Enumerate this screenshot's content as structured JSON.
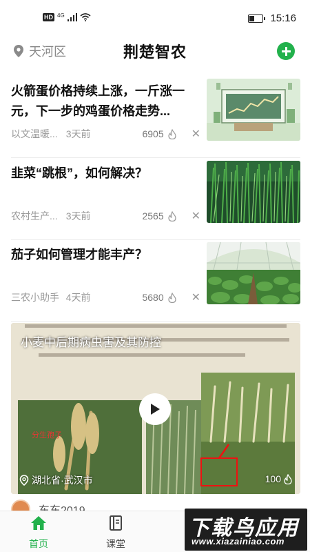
{
  "status_bar": {
    "hd": "HD",
    "network": "4G",
    "time": "15:16",
    "battery_level": 0.4
  },
  "header": {
    "location": "天河区",
    "title": "荆楚智农",
    "add_icon": "plus-circle-icon",
    "accent": "#22b14c"
  },
  "feed": [
    {
      "title": "火箭蛋价格持续上涨，一斤涨一元，下一步的鸡蛋价格走势...",
      "source": "以文温暖...",
      "time": "3天前",
      "views": "6905",
      "thumb": "chart-office-illustration"
    },
    {
      "title": "韭菜“跳根”，如何解决？",
      "source": "农村生产...",
      "time": "3天前",
      "views": "2565",
      "thumb": "chives-field-photo"
    },
    {
      "title": "茄子如何管理才能丰产？",
      "source": "三农小助手",
      "time": "4天前",
      "views": "5680",
      "thumb": "greenhouse-eggplant-photo"
    }
  ],
  "video": {
    "title": "小麦中后期病虫害及其防控",
    "location": "湖北省·武汉市",
    "count": "100",
    "play_icon": "play-icon"
  },
  "next_author": {
    "name": "东东2019"
  },
  "tabs": [
    {
      "label": "首页",
      "icon": "home-icon",
      "active": true
    },
    {
      "label": "课堂",
      "icon": "book-icon",
      "active": false
    }
  ],
  "watermark": {
    "main": "下载鸟应用",
    "sub": "www.xiazainiao.com"
  }
}
